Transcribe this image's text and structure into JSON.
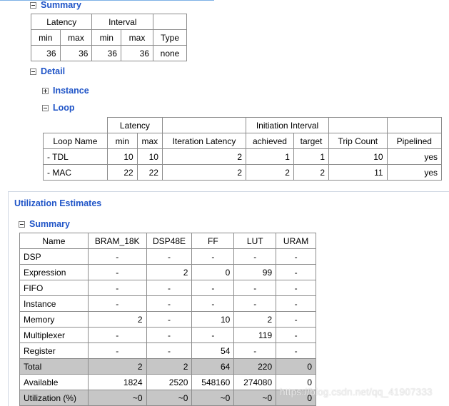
{
  "timing_summary": {
    "title": "Summary",
    "group_headers": [
      "Latency",
      "Interval",
      ""
    ],
    "col_headers": [
      "min",
      "max",
      "min",
      "max",
      "Type"
    ],
    "row": [
      "36",
      "36",
      "36",
      "36",
      "none"
    ]
  },
  "detail": {
    "title": "Detail",
    "instance_title": "Instance",
    "loop_title": "Loop",
    "loop_table": {
      "group_headers": [
        "",
        "Latency",
        "",
        "Initiation Interval",
        "",
        ""
      ],
      "col_headers": [
        "Loop Name",
        "min",
        "max",
        "Iteration Latency",
        "achieved",
        "target",
        "Trip Count",
        "Pipelined"
      ],
      "rows": [
        [
          "- TDL",
          "10",
          "10",
          "2",
          "1",
          "1",
          "10",
          "yes"
        ],
        [
          "- MAC",
          "22",
          "22",
          "2",
          "2",
          "2",
          "11",
          "yes"
        ]
      ]
    }
  },
  "utilization": {
    "title": "Utilization Estimates",
    "summary_title": "Summary",
    "col_headers": [
      "Name",
      "BRAM_18K",
      "DSP48E",
      "FF",
      "LUT",
      "URAM"
    ],
    "rows": [
      [
        "DSP",
        "-",
        "-",
        "-",
        "-",
        "-"
      ],
      [
        "Expression",
        "-",
        "2",
        "0",
        "99",
        "-"
      ],
      [
        "FIFO",
        "-",
        "-",
        "-",
        "-",
        "-"
      ],
      [
        "Instance",
        "-",
        "-",
        "-",
        "-",
        "-"
      ],
      [
        "Memory",
        "2",
        "-",
        "10",
        "2",
        "-"
      ],
      [
        "Multiplexer",
        "-",
        "-",
        "-",
        "119",
        "-"
      ],
      [
        "Register",
        "-",
        "-",
        "54",
        "-",
        "-"
      ],
      [
        "Total",
        "2",
        "2",
        "64",
        "220",
        "0"
      ],
      [
        "Available",
        "1824",
        "2520",
        "548160",
        "274080",
        "0"
      ],
      [
        "Utilization (%)",
        "~0",
        "~0",
        "~0",
        "~0",
        "0"
      ]
    ]
  },
  "watermark": "https://blog.csdn.net/qq_41907333"
}
